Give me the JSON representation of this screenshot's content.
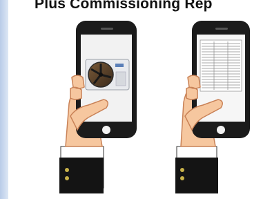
{
  "header": {
    "title": "Plus Commissioning Rep"
  },
  "colors": {
    "background": "#ffffff",
    "side_strip": "#b9cce8",
    "phone_body": "#1b1b1b",
    "hand_skin": "#f6c79f",
    "hand_outline": "#c98257",
    "sleeve": "#141414",
    "cuff": "#ffffff",
    "button": "#c9b24a"
  },
  "illustrations": [
    {
      "name": "hand-holding-phone-photo-icon",
      "screen_content": "outdoor-unit-photo"
    },
    {
      "name": "hand-holding-phone-report-icon",
      "screen_content": "commissioning-report-document"
    }
  ]
}
